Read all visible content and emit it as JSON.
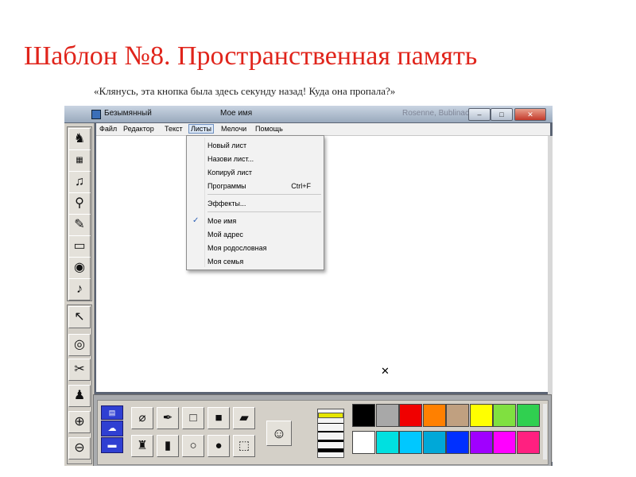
{
  "slide": {
    "title": "Шаблон №8. Пространственная память",
    "subtitle": "«Клянусь, эта кнопка была здесь секунду назад! Куда она пропала?»"
  },
  "window": {
    "doc_title": "Безымянный",
    "sheet_title": "Мое имя",
    "bg_title": "Rosenne, Bublinac..."
  },
  "menubar": {
    "items": [
      {
        "label": "Файл"
      },
      {
        "label": "Редактор"
      },
      {
        "label": "Текст"
      },
      {
        "label": "Листы",
        "active": true
      },
      {
        "label": "Мелочи"
      },
      {
        "label": "Помощь"
      }
    ]
  },
  "dropdown": {
    "items": [
      {
        "label": "Новый лист",
        "shortcut": ""
      },
      {
        "label": "Назови лист...",
        "shortcut": ""
      },
      {
        "label": "Копируй лист",
        "shortcut": ""
      },
      {
        "label": "Программы",
        "shortcut": "Ctrl+F"
      },
      {
        "label": "Эффекты...",
        "shortcut": ""
      },
      {
        "label": "Мое имя",
        "checked": true
      },
      {
        "label": "Мой адрес"
      },
      {
        "label": "Моя родословная"
      },
      {
        "label": "Моя семья"
      }
    ]
  },
  "left_toolbar": {
    "icons": [
      "puppet-icon",
      "keyboard-letters-icon",
      "music-note-icon",
      "microphone-icon",
      "paint-brush-icon",
      "film-strip-icon",
      "video-camera-icon",
      "sound-note-icon",
      "pointer-arrow-icon",
      "eye-icon",
      "scissors-icon",
      "rubber-stamp-icon",
      "zoom-in-icon",
      "zoom-out-icon"
    ]
  },
  "palette": {
    "top": [
      "#000000",
      "#a8a8a8",
      "#f00000",
      "#ff8000",
      "#c0a080",
      "#ffff00",
      "#80e040",
      "#30d050"
    ],
    "bottom": [
      "#ffffff",
      "#00e0e0",
      "#00c8ff",
      "#00a8d8",
      "#0030ff",
      "#a000ff",
      "#ff00ff",
      "#ff2080"
    ],
    "accent": "#2f3fd2"
  }
}
